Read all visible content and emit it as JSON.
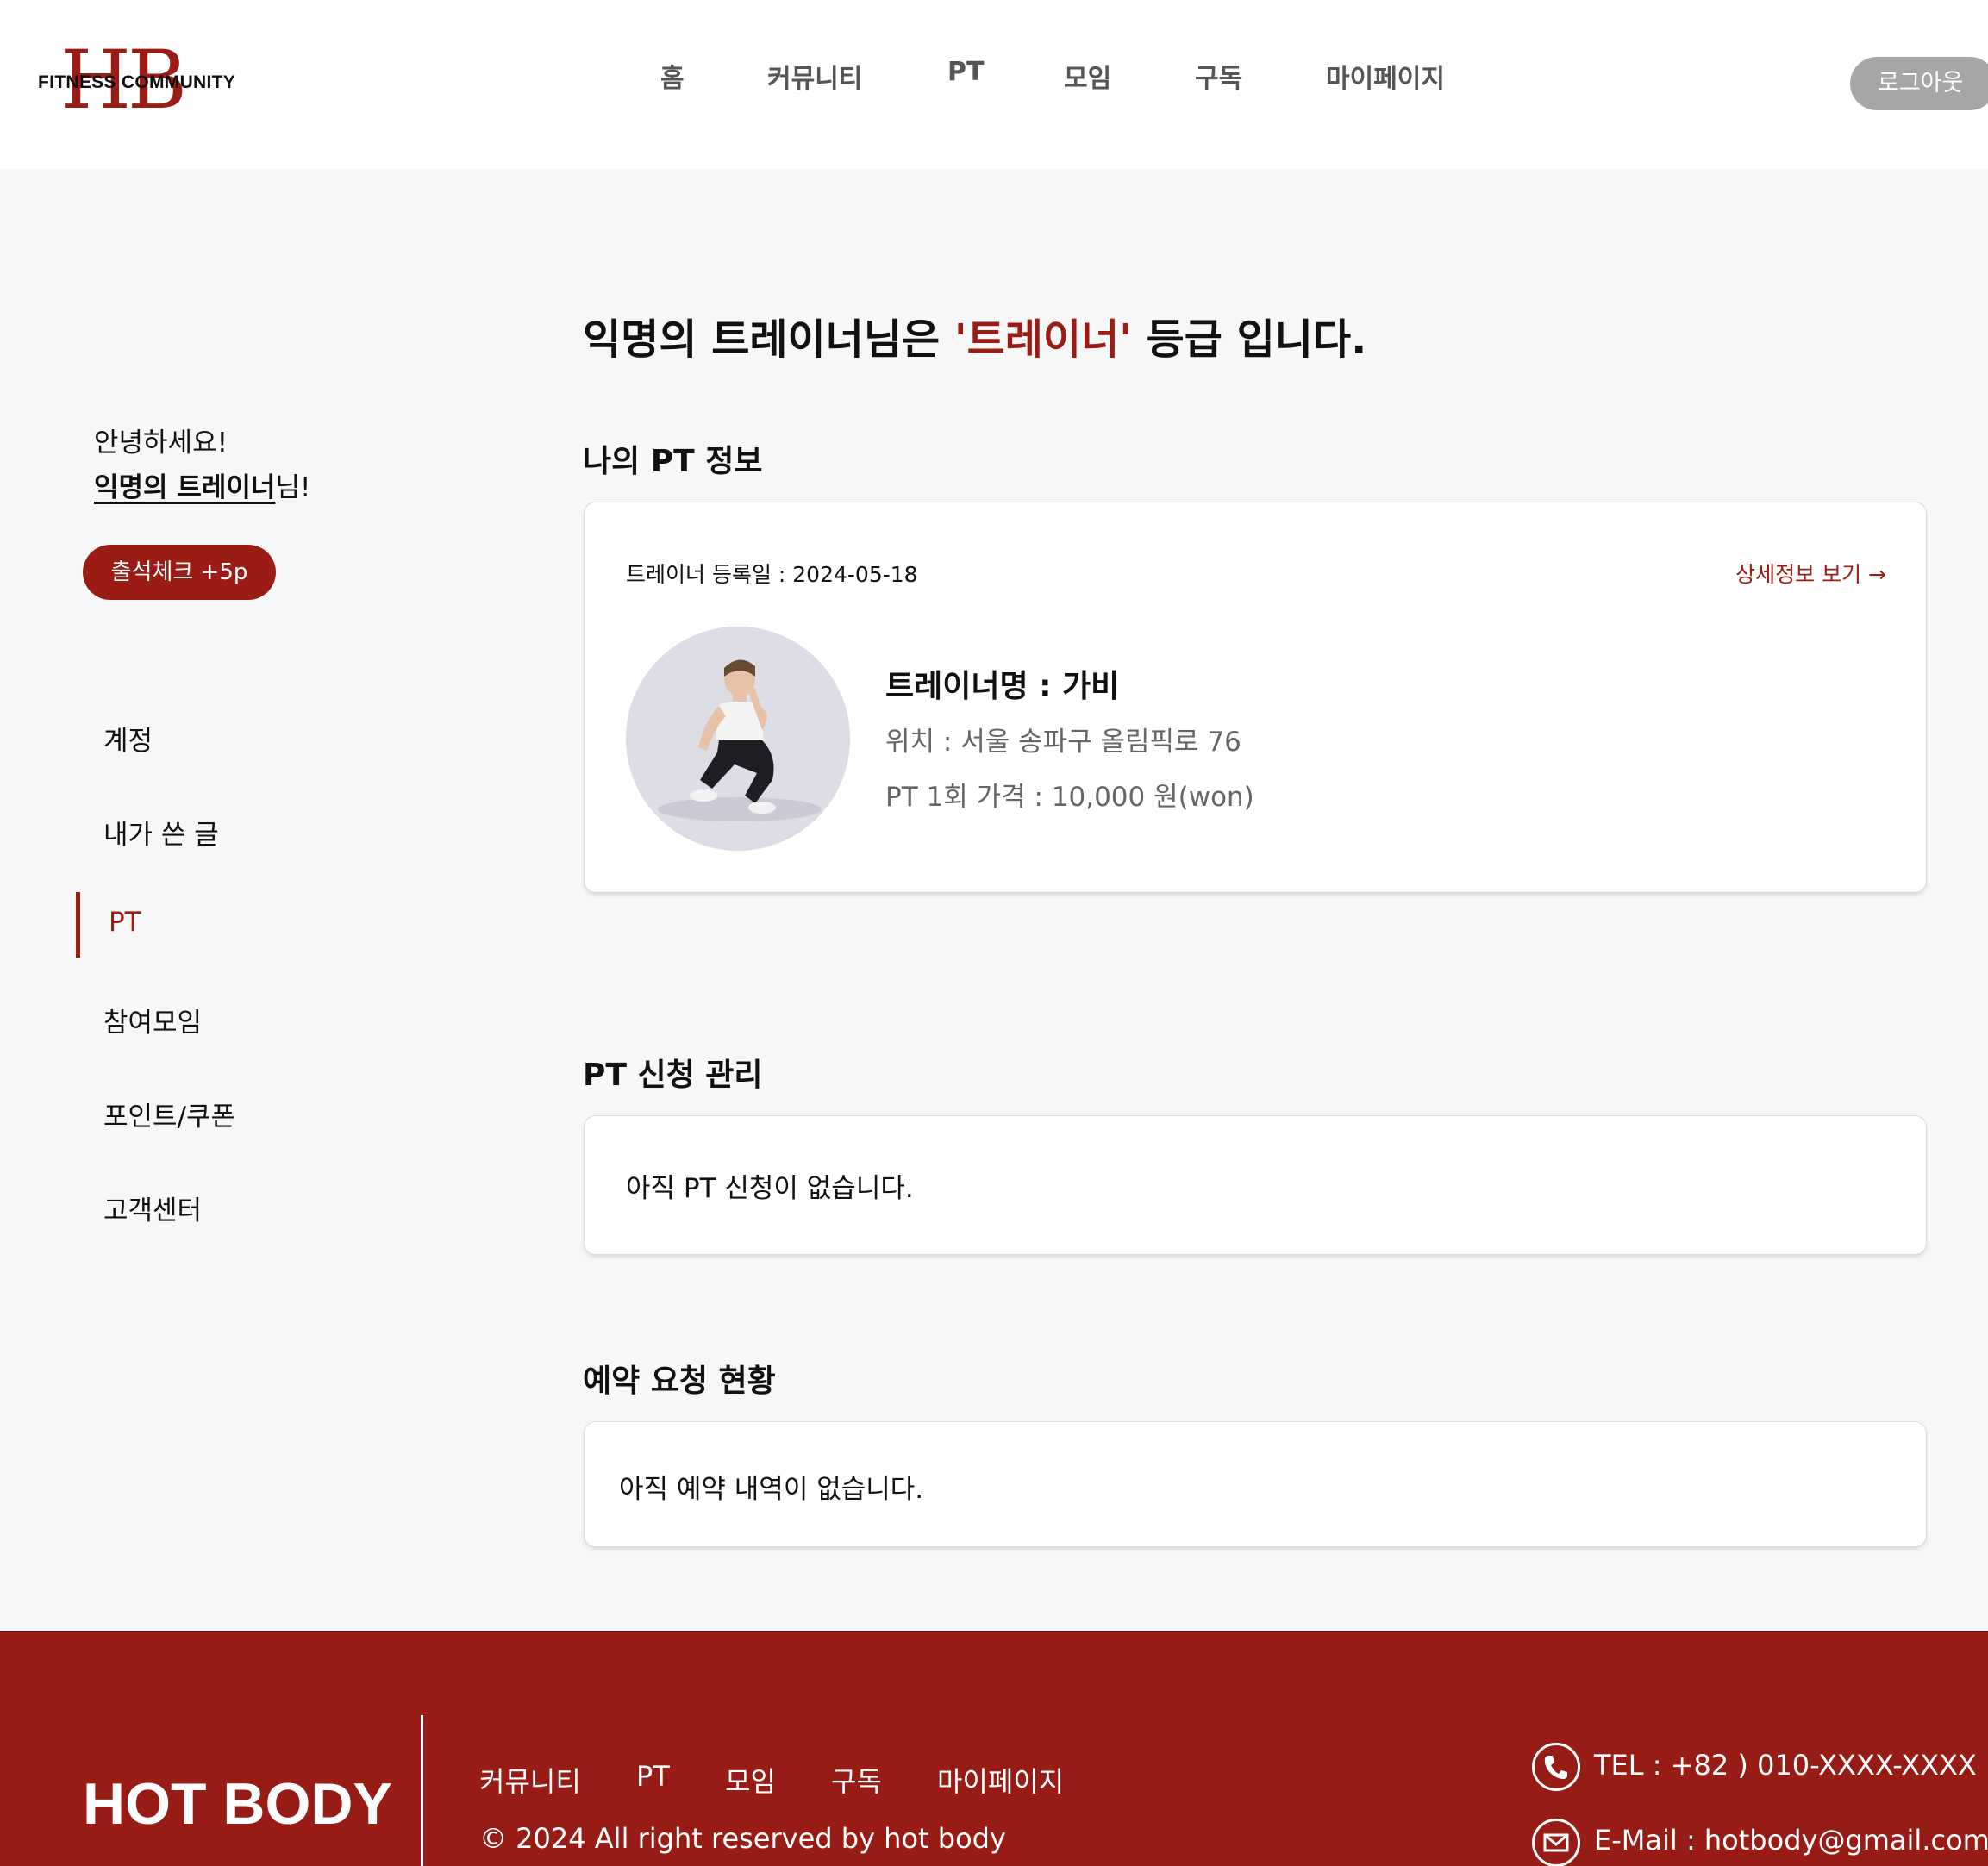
{
  "header": {
    "logo_letters": "HB",
    "logo_text": "FITNESS COMMUNITY",
    "nav": [
      "홈",
      "커뮤니티",
      "PT",
      "모임",
      "구독",
      "마이페이지"
    ],
    "logout_label": "로그아웃"
  },
  "sidebar": {
    "greeting": "안녕하세요!",
    "user_name": "익명의 트레이너",
    "honorific": "님!",
    "attendance_label": "출석체크 +5p",
    "items": [
      {
        "label": "계정"
      },
      {
        "label": "내가 쓴 글"
      },
      {
        "label": "PT",
        "active": true
      },
      {
        "label": "참여모임"
      },
      {
        "label": "포인트/쿠폰"
      },
      {
        "label": "고객센터"
      }
    ]
  },
  "main": {
    "grade_prefix": "익명의 트레이너님은 ",
    "grade_value": "'트레이너'",
    "grade_suffix": " 등급 입니다.",
    "pt_info": {
      "title": "나의 PT 정보",
      "registered": "트레이너 등록일 : 2024-05-18",
      "detail_link": "상세정보 보기 →",
      "trainer_name": "트레이너명 : 가비",
      "location": "위치 : 서울 송파구 올림픽로 76",
      "price": "PT 1회 가격 : 10,000 원(won)"
    },
    "pt_requests": {
      "title": "PT 신청 관리",
      "empty": "아직 PT 신청이 없습니다."
    },
    "reservations": {
      "title": "예약 요청 현황",
      "empty": "아직 예약 내역이 없습니다."
    }
  },
  "footer": {
    "brand": "HOT BODY",
    "nav": [
      "커뮤니티",
      "PT",
      "모임",
      "구독",
      "마이페이지"
    ],
    "copyright": "© 2024 All right reserved by hot body",
    "tel": "TEL : +82 ) 010-XXXX-XXXX",
    "email": "E-Mail : hotbody@gmail.com"
  },
  "colors": {
    "brand_red": "#9b1c15",
    "footer_red": "#961c15",
    "background": "#f7f7f7"
  },
  "icons": [
    "phone-icon",
    "mail-icon"
  ]
}
